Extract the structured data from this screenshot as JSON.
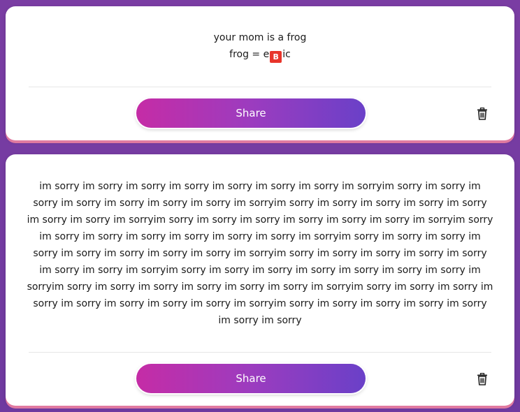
{
  "posts": [
    {
      "lines": [
        "your mom is a frog"
      ],
      "line2_prefix": "frog = e",
      "emoji": {
        "name": "b-button-icon",
        "glyph": "B",
        "color": "#e8352b"
      },
      "line2_suffix": "ic",
      "share_label": "Share"
    },
    {
      "text": "im sorry im sorry im sorry im sorry im sorry im sorry im sorry im sorryim sorry im sorry im sorry im sorry im sorry im sorry im sorry im sorryim sorry im sorry im sorry im sorry im sorry im sorry im sorry im sorryim sorry im sorry im sorry im sorry im sorry im sorry im sorryim sorry im sorry im sorry im sorry im sorry im sorry im sorry im sorryim sorry im sorry im sorry im sorry im sorry im sorry im sorry im sorry im sorryim sorry im sorry im sorry im sorry im sorry im sorry im sorry im sorryim sorry im sorry im sorry im sorry im sorry im sorry im sorry im sorryim sorry im sorry im sorry im sorry im sorry im sorry im sorryim sorry im sorry im sorry im sorry im sorry im sorry im sorry im sorry im sorryim sorry im sorry im sorry im sorry im sorry im sorry im sorry",
      "share_label": "Share"
    }
  ],
  "colors": {
    "background": "#7a3da3",
    "card": "#ffffff",
    "card_shadow": "#e07aa0",
    "button_start": "#c52ca6",
    "button_end": "#6a40c8"
  },
  "icons": {
    "delete": "trash-icon"
  }
}
